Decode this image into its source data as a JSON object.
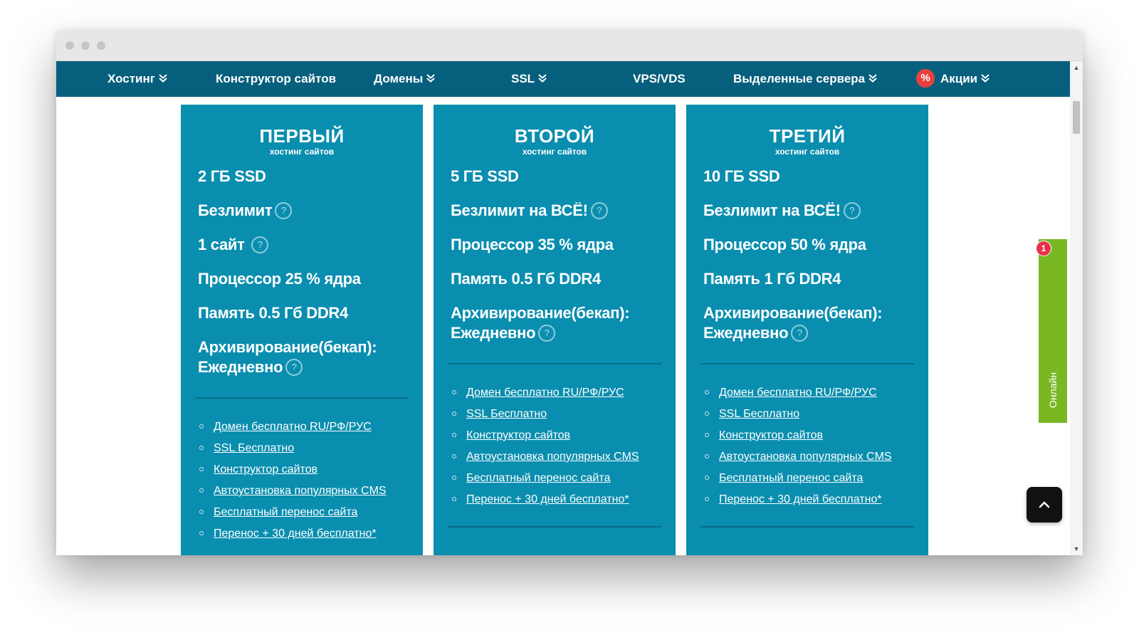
{
  "nav": {
    "hosting": "Хостинг",
    "constructor": "Конструктор сайтов",
    "domains": "Домены",
    "ssl": "SSL",
    "vps": "VPS/VDS",
    "dedicated": "Выделенные сервера",
    "promo": "Акции",
    "promo_badge": "%"
  },
  "plans": [
    {
      "title": "ПЕРВЫЙ",
      "subtitle": "хостинг сайтов",
      "specs": [
        "2 ГБ SSD",
        "Безлимит",
        "1 сайт",
        "Процессор 25 % ядра",
        "Память 0.5 Гб DDR4",
        "Архивирование(бекап):",
        "Ежедневно"
      ],
      "features": [
        "Домен бесплатно RU/РФ/РУС",
        "SSL Бесплатно",
        "Конструктор сайтов",
        "Автоустановка популярных CMS",
        "Бесплатный перенос сайта",
        "Перенос + 30 дней бесплатно*"
      ]
    },
    {
      "title": "ВТОРОЙ",
      "subtitle": "хостинг сайтов",
      "specs": [
        "5 ГБ SSD",
        "Безлимит на ВСЁ!",
        "Процессор 35 % ядра",
        "Память 0.5 Гб DDR4",
        "Архивирование(бекап):",
        "Ежедневно"
      ],
      "features": [
        "Домен бесплатно RU/РФ/РУС",
        "SSL Бесплатно",
        "Конструктор сайтов",
        "Автоустановка популярных CMS",
        "Бесплатный перенос сайта",
        "Перенос + 30 дней бесплатно*"
      ]
    },
    {
      "title": "ТРЕТИЙ",
      "subtitle": "хостинг сайтов",
      "specs": [
        "10 ГБ SSD",
        "Безлимит на ВСЁ!",
        "Процессор 50 % ядра",
        "Память 1 Гб DDR4",
        "Архивирование(бекап):",
        "Ежедневно"
      ],
      "features": [
        "Домен бесплатно RU/РФ/РУС",
        "SSL Бесплатно",
        "Конструктор сайтов",
        "Автоустановка популярных CMS",
        "Бесплатный перенос сайта",
        "Перенос + 30 дней бесплатно*"
      ]
    }
  ],
  "widgets": {
    "online_label": "Онлайн",
    "notification_count": "1"
  },
  "help_icon_glyph": "?",
  "colors": {
    "nav_bg": "#06607d",
    "card_bg": "#0a8eaf",
    "online_green": "#79b823",
    "badge_red": "#e8314a"
  }
}
